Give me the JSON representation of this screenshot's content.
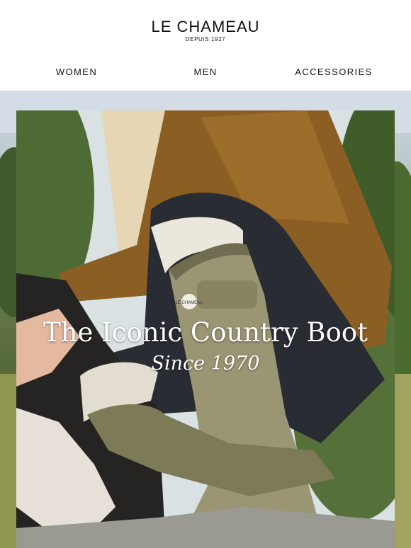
{
  "header": {
    "brand": "LE CHAMEAU",
    "tagline": "DEPUIS 1927"
  },
  "nav": {
    "items": [
      {
        "label": "WOMEN"
      },
      {
        "label": "MEN"
      },
      {
        "label": "ACCESSORIES"
      }
    ]
  },
  "hero": {
    "title": "The Iconic Country Boot",
    "subtitle": "Since 1970",
    "boot_badge": "LE CHAMEAU"
  }
}
